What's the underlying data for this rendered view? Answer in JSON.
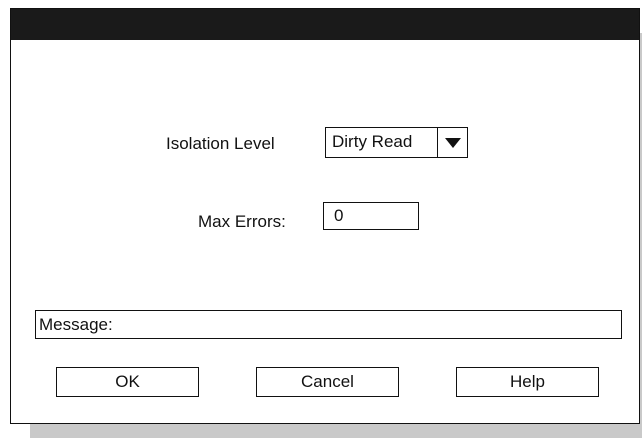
{
  "dialog": {
    "isolation_label": "Isolation Level",
    "isolation_value": "Dirty Read",
    "max_errors_label": "Max Errors:",
    "max_errors_value": "0",
    "message_label": "Message:",
    "buttons": {
      "ok": "OK",
      "cancel": "Cancel",
      "help": "Help"
    }
  },
  "icons": {
    "dropdown": "triangle-down-icon"
  },
  "colors": {
    "titlebar": "#1a1a1a",
    "shadow": "#c9c9c9",
    "border": "#111111",
    "background": "#ffffff"
  }
}
